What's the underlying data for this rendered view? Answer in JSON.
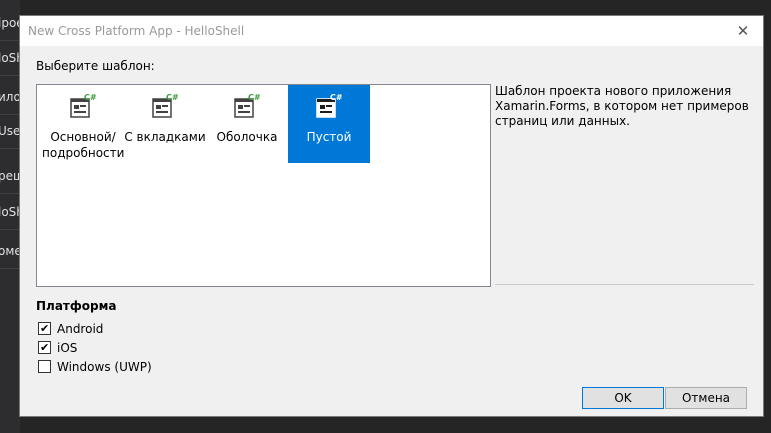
{
  "background": {
    "items": [
      "ipoe",
      "loShe",
      "илож",
      "Users",
      "реши",
      "loShe",
      "оме"
    ]
  },
  "dialog": {
    "title": "New Cross Platform App - HelloShell",
    "close_glyph": "✕",
    "choose_template_label": "Выберите шаблон:",
    "templates": [
      {
        "label_line1": "Основной/",
        "label_line2": "подробности",
        "selected": false
      },
      {
        "label_line1": "С вкладками",
        "label_line2": "",
        "selected": false
      },
      {
        "label_line1": "Оболочка",
        "label_line2": "",
        "selected": false
      },
      {
        "label_line1": "Пустой",
        "label_line2": "",
        "selected": true
      }
    ],
    "template_badge": "C#",
    "description_lines": [
      "Шаблон проекта нового приложения",
      "Xamarin.Forms, в котором нет примеров",
      "страниц или данных."
    ],
    "platform_title": "Платформа",
    "platforms": [
      {
        "label": "Android",
        "checked": true
      },
      {
        "label": "iOS",
        "checked": true
      },
      {
        "label": "Windows (UWP)",
        "checked": false
      }
    ],
    "check_glyph": "✔",
    "ok_label": "OK",
    "cancel_label": "Отмена"
  },
  "colors": {
    "selected": "#0078d7",
    "dialog_bg": "#f0f0f0",
    "ide_bg": "#252526",
    "badge_green": "#3b9e3b"
  }
}
